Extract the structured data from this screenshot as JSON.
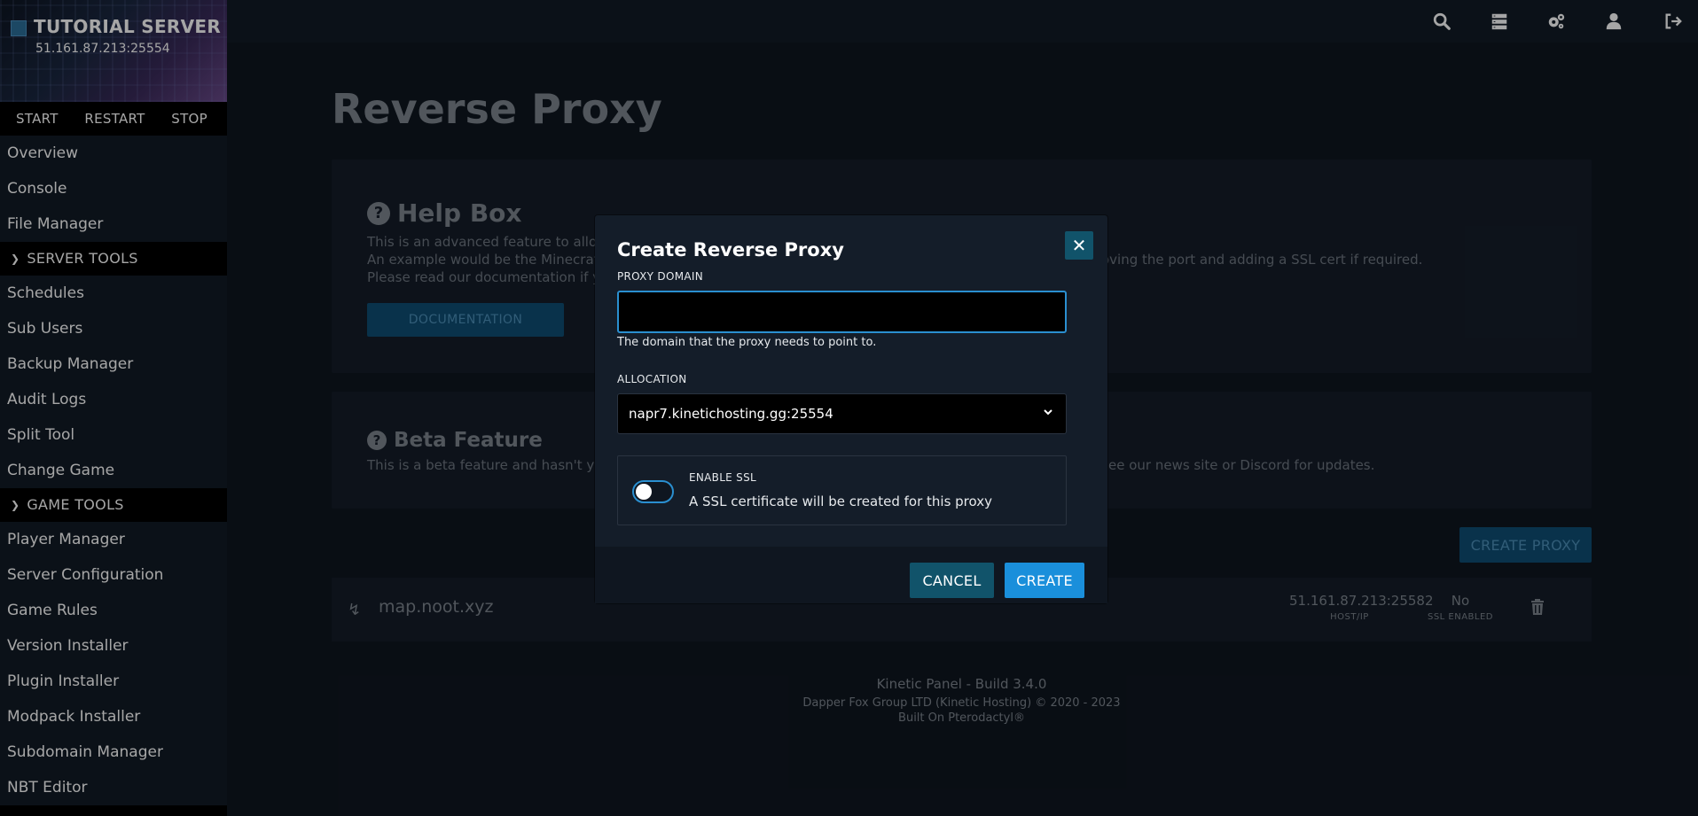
{
  "server": {
    "name": "TUTORIAL SERVER",
    "ip": "51.161.87.213:25554"
  },
  "power": {
    "start": "START",
    "restart": "RESTART",
    "stop": "STOP"
  },
  "nav": {
    "top": [
      "Overview",
      "Console",
      "File Manager"
    ],
    "server_tools_label": "SERVER TOOLS",
    "server_tools": [
      "Schedules",
      "Sub Users",
      "Backup Manager",
      "Audit Logs",
      "Split Tool",
      "Change Game"
    ],
    "game_tools_label": "GAME TOOLS",
    "game_tools": [
      "Player Manager",
      "Server Configuration",
      "Game Rules",
      "Version Installer",
      "Plugin Installer",
      "Modpack Installer",
      "Subdomain Manager",
      "NBT Editor"
    ]
  },
  "topbar": {
    "icons": [
      "search-icon",
      "servers-icon",
      "settings-icon",
      "account-icon",
      "logout-icon"
    ]
  },
  "page": {
    "title": "Reverse Proxy"
  },
  "helpbox": {
    "title": "Help Box",
    "line1": "This is an advanced feature to allow",
    "line2": "An example would be the Minecraft",
    "line2_end": "oving the port and adding a SSL cert if required.",
    "line3": "Please read our documentation if yo",
    "doc_button": "DOCUMENTATION"
  },
  "beta": {
    "title": "Beta Feature",
    "line1": "This is a beta feature and hasn't yet",
    "line1_end": "ee our news site or Discord for updates."
  },
  "create_proxy_button": "CREATE PROXY",
  "proxy": {
    "domain": "map.noot.xyz",
    "host": "51.161.87.213:25582",
    "host_label": "HOST/IP",
    "ssl": "No",
    "ssl_label": "SSL ENABLED"
  },
  "footer": {
    "line1": "Kinetic Panel - Build 3.4.0",
    "line2": "Dapper Fox Group LTD (Kinetic Hosting) © 2020 - 2023",
    "line3": "Built On Pterodactyl®"
  },
  "modal": {
    "title": "Create Reverse Proxy",
    "domain_label": "PROXY DOMAIN",
    "domain_value": "",
    "domain_help": "The domain that the proxy needs to point to.",
    "allocation_label": "ALLOCATION",
    "allocation_value": "napr7.kinetichosting.gg:25554",
    "ssl_label": "ENABLE SSL",
    "ssl_desc": "A SSL certificate will be created for this proxy",
    "ssl_enabled": false,
    "cancel": "CANCEL",
    "create": "CREATE"
  }
}
